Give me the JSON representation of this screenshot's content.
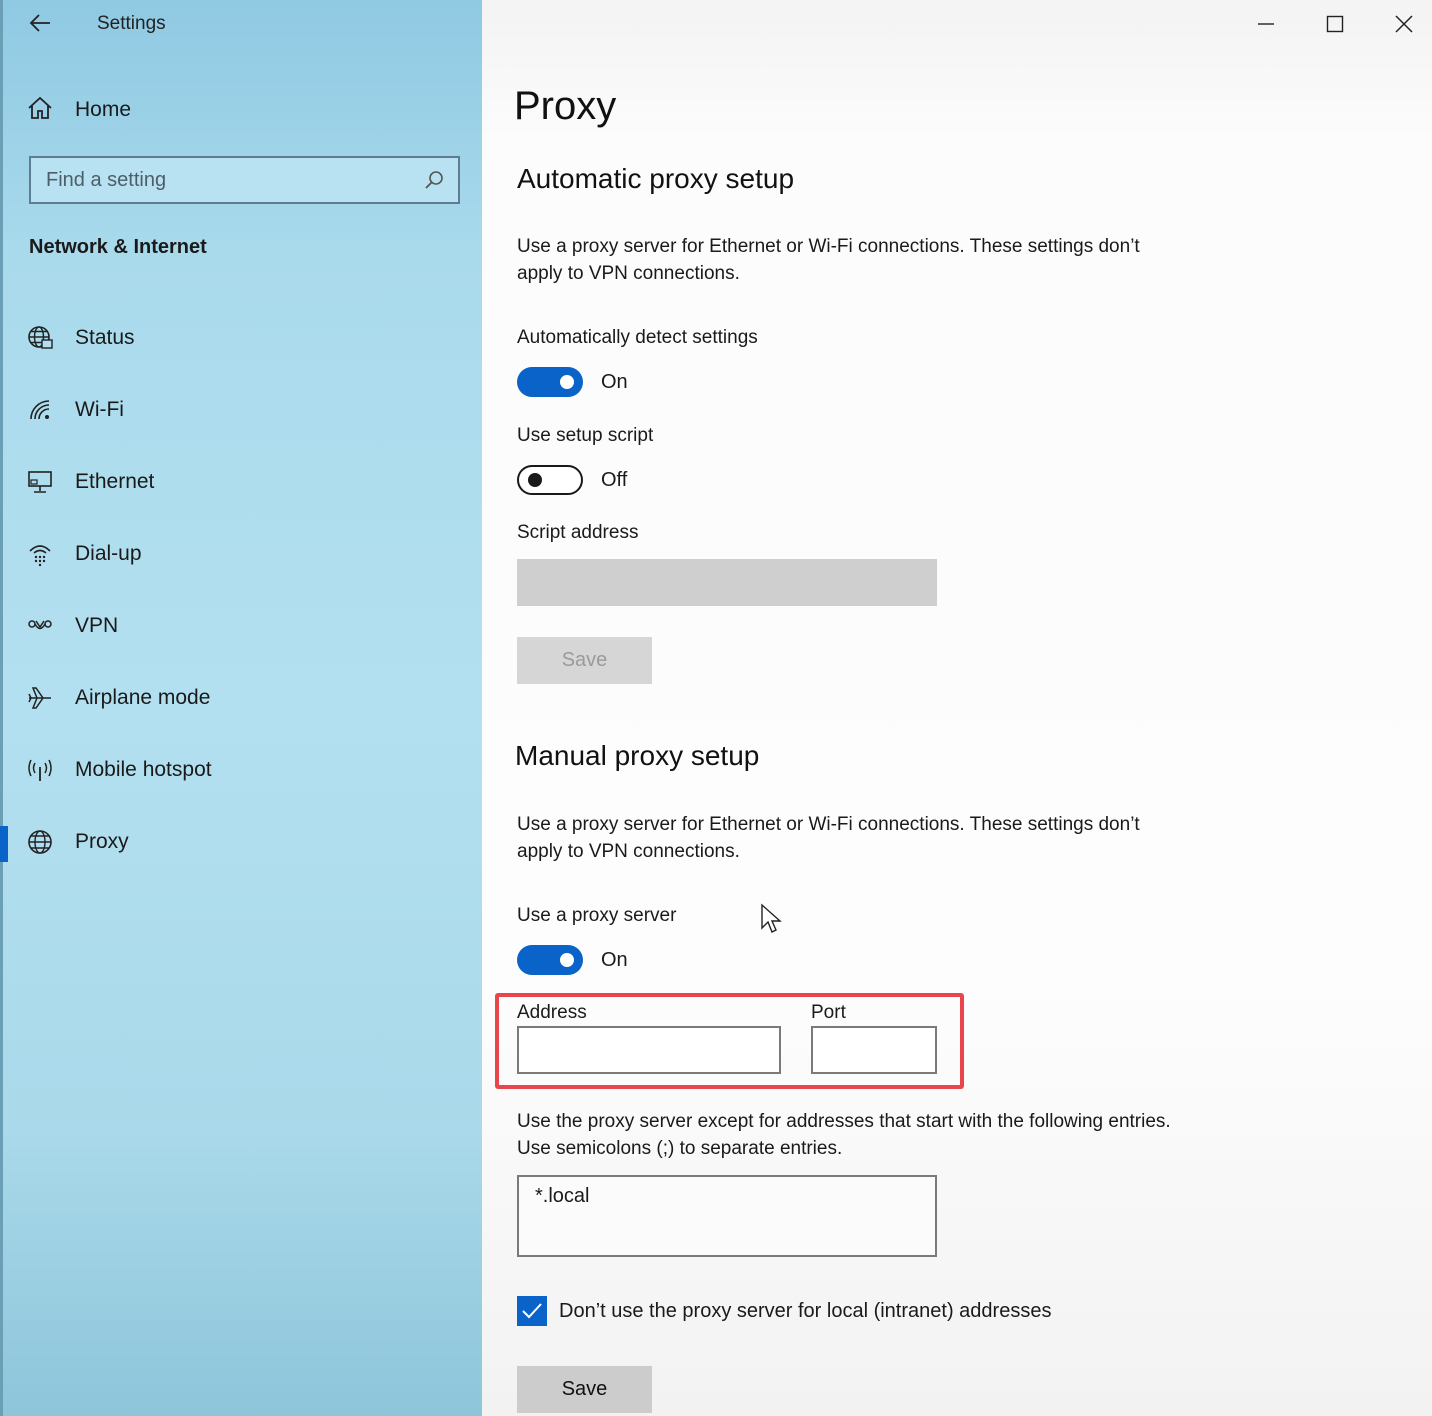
{
  "app": {
    "title": "Settings"
  },
  "sidebar": {
    "home_label": "Home",
    "search_placeholder": "Find a setting",
    "section_header": "Network & Internet",
    "items": [
      {
        "label": "Status",
        "icon": "globe-status-icon"
      },
      {
        "label": "Wi-Fi",
        "icon": "wifi-icon"
      },
      {
        "label": "Ethernet",
        "icon": "ethernet-icon"
      },
      {
        "label": "Dial-up",
        "icon": "dialup-icon"
      },
      {
        "label": "VPN",
        "icon": "vpn-icon"
      },
      {
        "label": "Airplane mode",
        "icon": "airplane-icon"
      },
      {
        "label": "Mobile hotspot",
        "icon": "hotspot-icon"
      },
      {
        "label": "Proxy",
        "icon": "globe-icon",
        "active": true
      }
    ]
  },
  "page": {
    "title": "Proxy",
    "automatic": {
      "heading": "Automatic proxy setup",
      "description": "Use a proxy server for Ethernet or Wi-Fi connections. These settings don’t apply to VPN connections.",
      "detect_label": "Automatically detect settings",
      "detect_state": "On",
      "script_label": "Use setup script",
      "script_state": "Off",
      "script_address_label": "Script address",
      "script_address_value": "",
      "save_label": "Save"
    },
    "manual": {
      "heading": "Manual proxy setup",
      "description": "Use a proxy server for Ethernet or Wi-Fi connections. These settings don’t apply to VPN connections.",
      "use_proxy_label": "Use a proxy server",
      "use_proxy_state": "On",
      "address_label": "Address",
      "address_value": "",
      "port_label": "Port",
      "port_value": "",
      "exceptions_description": "Use the proxy server except for addresses that start with the following entries. Use semicolons (;) to separate entries.",
      "exceptions_value": "*.local",
      "local_bypass_label": "Don’t use the proxy server for local (intranet) addresses",
      "local_bypass_checked": true,
      "save_label": "Save"
    }
  },
  "colors": {
    "accent": "#0a63c9",
    "highlight": "#e8454c"
  }
}
